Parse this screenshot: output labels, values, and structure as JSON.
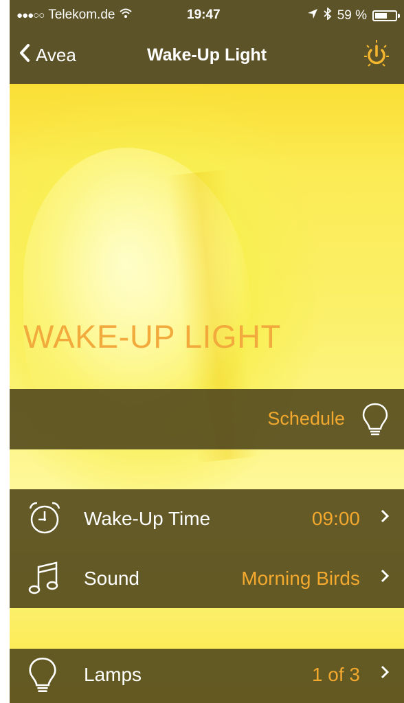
{
  "status_bar": {
    "signal_dots": "●●●○○",
    "carrier": "Telekom.de",
    "time": "19:47",
    "battery_percent": "59 %",
    "battery_level": 0.59,
    "icons": [
      "wifi-icon",
      "location-icon",
      "bluetooth-icon",
      "battery-icon"
    ]
  },
  "nav": {
    "back_label": "Avea",
    "title": "Wake-Up Light",
    "power_icon": "power-icon"
  },
  "hero": {
    "title": "WAKE-UP LIGHT"
  },
  "schedule": {
    "label": "Schedule",
    "icon": "lightbulb-icon"
  },
  "settings": {
    "rows": [
      {
        "label": "Wake-Up Time",
        "value": "09:00",
        "icon": "alarm-clock-icon"
      },
      {
        "label": "Sound",
        "value": "Morning Birds",
        "icon": "music-note-icon"
      }
    ]
  },
  "lamps": {
    "label": "Lamps",
    "value": "1 of 3",
    "icon": "lightbulb-icon"
  },
  "colors": {
    "bar_background": "#5d5329",
    "accent_orange": "#f3a82e",
    "hero_text": "#f2aa3d",
    "screen_yellow": "#fbe43a"
  }
}
